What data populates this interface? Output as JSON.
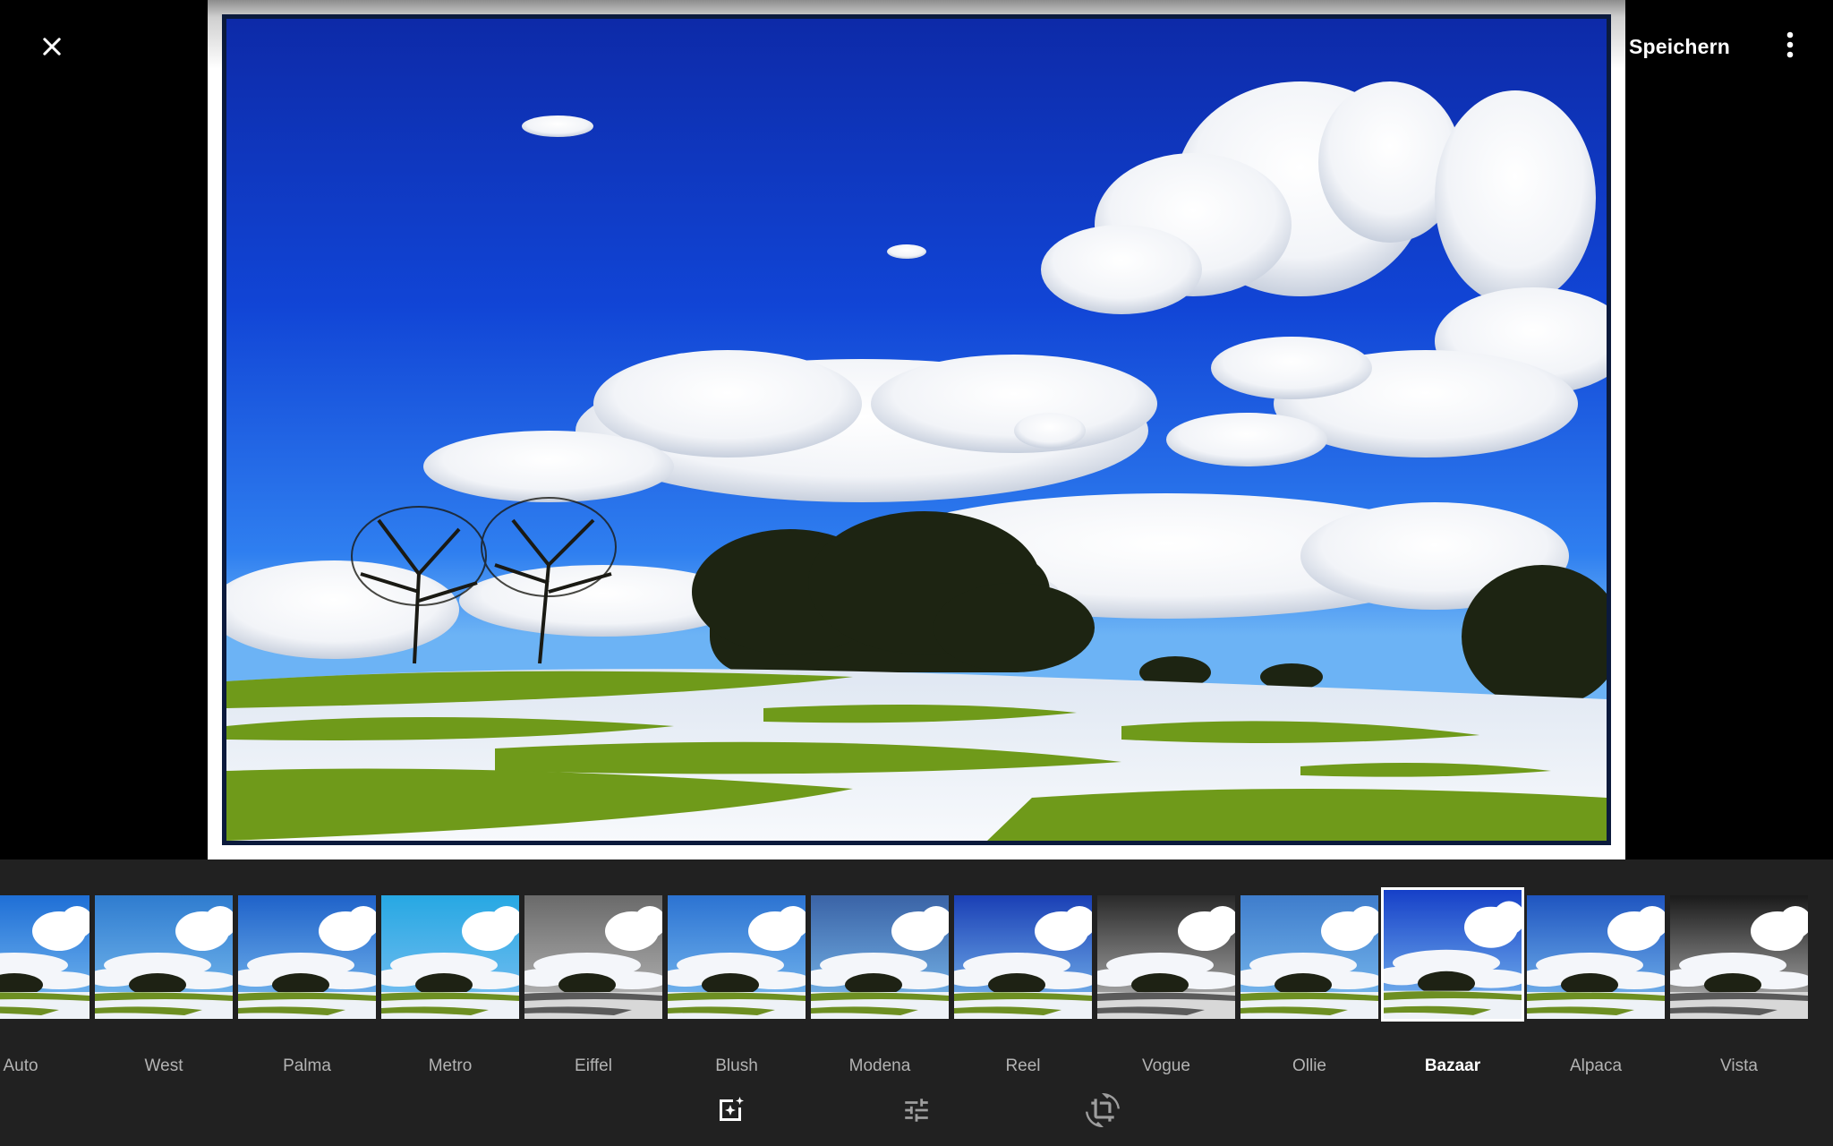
{
  "toolbar": {
    "save_label": "Speichern"
  },
  "filters": {
    "selected": "Bazaar",
    "items": [
      {
        "label": "Auto",
        "tint": "#1f6fd6",
        "sat": 1.0,
        "gray": false
      },
      {
        "label": "West",
        "tint": "#2f7ccf",
        "sat": 0.8,
        "gray": false
      },
      {
        "label": "Palma",
        "tint": "#1f62c9",
        "sat": 1.0,
        "gray": false
      },
      {
        "label": "Metro",
        "tint": "#27a8e3",
        "sat": 1.1,
        "gray": false
      },
      {
        "label": "Eiffel",
        "tint": "#6a6a6a",
        "sat": 0.0,
        "gray": true
      },
      {
        "label": "Blush",
        "tint": "#2c73d2",
        "sat": 0.9,
        "gray": false
      },
      {
        "label": "Modena",
        "tint": "#3a63a6",
        "sat": 0.7,
        "gray": false
      },
      {
        "label": "Reel",
        "tint": "#1a3fb5",
        "sat": 1.2,
        "gray": false
      },
      {
        "label": "Vogue",
        "tint": "#2a2a2a",
        "sat": 0.0,
        "gray": true
      },
      {
        "label": "Ollie",
        "tint": "#3f7dcc",
        "sat": 0.8,
        "gray": false
      },
      {
        "label": "Bazaar",
        "tint": "#1640c8",
        "sat": 1.2,
        "gray": false
      },
      {
        "label": "Alpaca",
        "tint": "#1f55c0",
        "sat": 1.0,
        "gray": false
      },
      {
        "label": "Vista",
        "tint": "#1a1a1a",
        "sat": 0.0,
        "gray": true
      }
    ]
  },
  "tools": {
    "active": "filters"
  }
}
